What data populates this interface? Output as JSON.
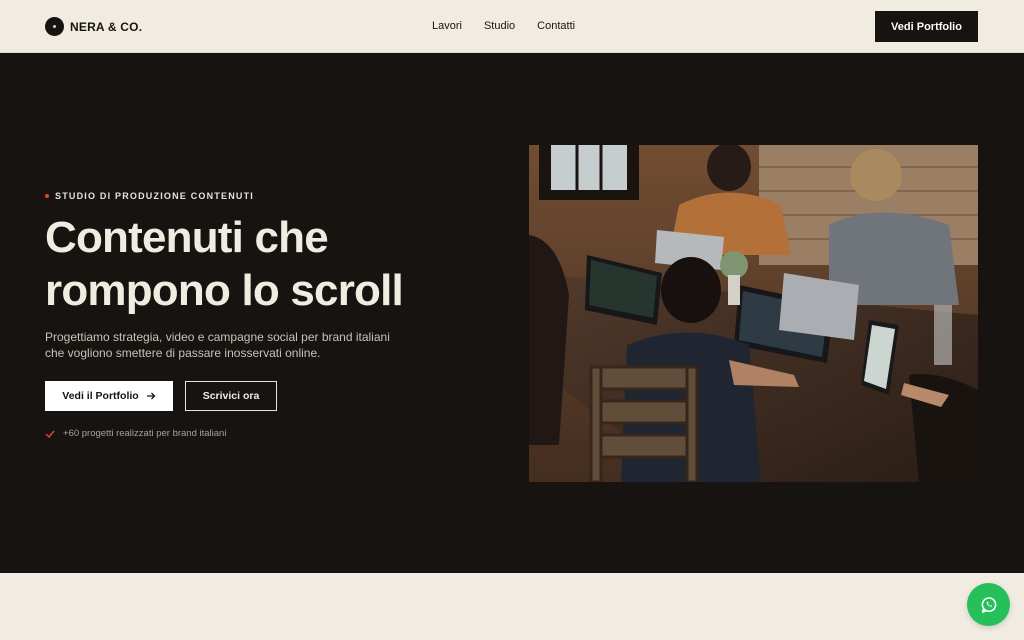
{
  "header": {
    "brand": "NERA & CO.",
    "nav": [
      "Lavori",
      "Studio",
      "Contatti"
    ],
    "cta": "Vedi Portfolio"
  },
  "hero": {
    "eyebrow": "STUDIO DI PRODUZIONE CONTENUTI",
    "headline_line1": "Contenuti che",
    "headline_line2": "rompono lo scroll",
    "description": "Progettiamo strategia, video e campagne social per brand italiani che vogliono smettere di passare inosservati online.",
    "primary_button": "Vedi il Portfolio",
    "secondary_button": "Scrivici ora",
    "proof": "+60 progetti realizzati per brand italiani"
  },
  "icons": {
    "logo": "vinyl-record-icon",
    "primary_arrow": "arrow-right-icon",
    "proof": "check-icon",
    "floating": "whatsapp-icon"
  },
  "colors": {
    "background": "#f1ece2",
    "hero_background": "#161311",
    "accent": "#e2452f",
    "whatsapp": "#25c05a"
  }
}
